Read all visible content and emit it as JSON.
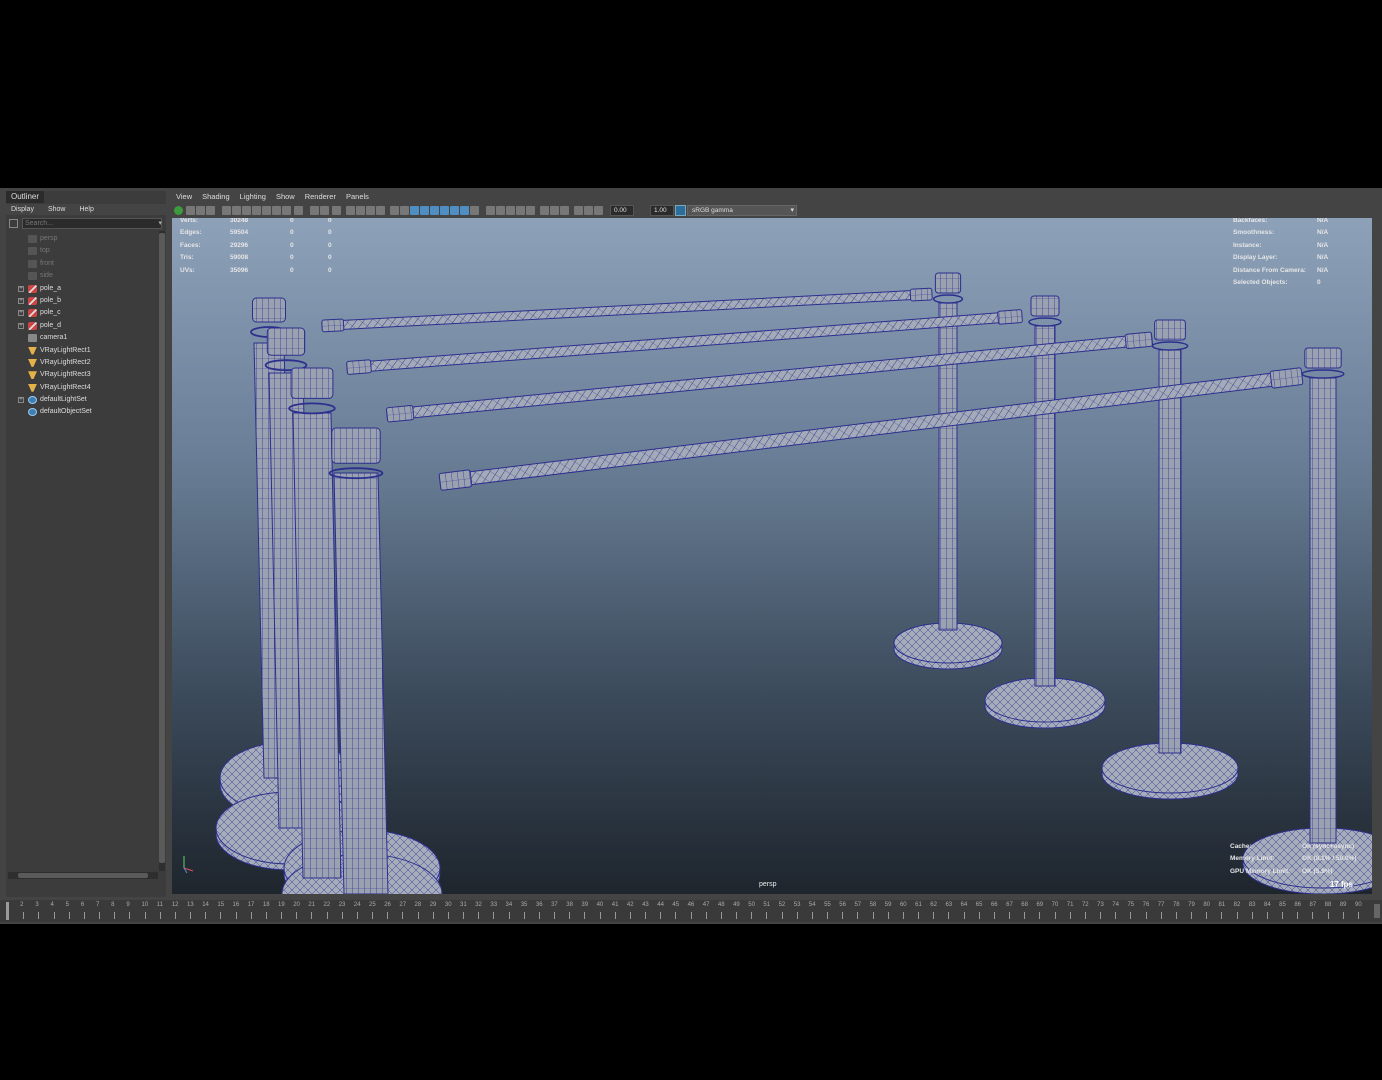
{
  "outliner": {
    "tab_label": "Outliner",
    "menu": [
      "Display",
      "Show",
      "Help"
    ],
    "search_placeholder": "Search...",
    "items": [
      {
        "label": "persp",
        "icon": "camera-icon",
        "dim": true,
        "expandable": false
      },
      {
        "label": "top",
        "icon": "camera-icon",
        "dim": true,
        "expandable": false
      },
      {
        "label": "front",
        "icon": "camera-icon",
        "dim": true,
        "expandable": false
      },
      {
        "label": "side",
        "icon": "camera-icon",
        "dim": true,
        "expandable": false
      },
      {
        "label": "pole_a",
        "icon": "transform-icon",
        "dim": false,
        "expandable": true
      },
      {
        "label": "pole_b",
        "icon": "transform-icon",
        "dim": false,
        "expandable": true
      },
      {
        "label": "pole_c",
        "icon": "transform-icon",
        "dim": false,
        "expandable": true
      },
      {
        "label": "pole_d",
        "icon": "transform-icon",
        "dim": false,
        "expandable": true
      },
      {
        "label": "camera1",
        "icon": "camera-icon",
        "dim": false,
        "expandable": false
      },
      {
        "label": "VRayLightRect1",
        "icon": "area-light-icon",
        "dim": false,
        "expandable": false
      },
      {
        "label": "VRayLightRect2",
        "icon": "area-light-icon",
        "dim": false,
        "expandable": false
      },
      {
        "label": "VRayLightRect3",
        "icon": "area-light-icon",
        "dim": false,
        "expandable": false
      },
      {
        "label": "VRayLightRect4",
        "icon": "area-light-icon",
        "dim": false,
        "expandable": false
      },
      {
        "label": "defaultLightSet",
        "icon": "set-icon",
        "dim": false,
        "expandable": true
      },
      {
        "label": "defaultObjectSet",
        "icon": "set-icon",
        "dim": false,
        "expandable": false
      }
    ]
  },
  "panel": {
    "menu": [
      "View",
      "Shading",
      "Lighting",
      "Show",
      "Renderer",
      "Panels"
    ],
    "toolbar": {
      "exposure": "0.00",
      "gamma": "1.00",
      "color_space": "sRGB gamma"
    }
  },
  "hud_left": {
    "rows": [
      {
        "label": "Verts:",
        "v1": "30248",
        "v2": "0",
        "v3": "0"
      },
      {
        "label": "Edges:",
        "v1": "59504",
        "v2": "0",
        "v3": "0"
      },
      {
        "label": "Faces:",
        "v1": "29296",
        "v2": "0",
        "v3": "0"
      },
      {
        "label": "Tris:",
        "v1": "59008",
        "v2": "0",
        "v3": "0"
      },
      {
        "label": "UVs:",
        "v1": "35096",
        "v2": "0",
        "v3": "0"
      }
    ]
  },
  "hud_right": {
    "rows": [
      {
        "label": "Backfaces:",
        "value": "N/A"
      },
      {
        "label": "Smoothness:",
        "value": "N/A"
      },
      {
        "label": "Instance:",
        "value": "N/A"
      },
      {
        "label": "Display Layer:",
        "value": "N/A"
      },
      {
        "label": "Distance From Camera:",
        "value": "N/A"
      },
      {
        "label": "Selected Objects:",
        "value": "0"
      }
    ]
  },
  "hud_bottom": {
    "rows": [
      {
        "label": "Cache:",
        "value": "On (sync+async)"
      },
      {
        "label": "Memory Limit:",
        "value": "OK (8.1% / 50.0%)"
      },
      {
        "label": "GPU Memory Limit:",
        "value": "OK (5.9%)"
      }
    ]
  },
  "viewport": {
    "camera_label": "persp",
    "fps": "17 fps",
    "wire_color": "#2c2f8e",
    "surface_color": "#9aa2b1"
  },
  "timeslider": {
    "start": 1,
    "end": 90,
    "current": 1
  }
}
